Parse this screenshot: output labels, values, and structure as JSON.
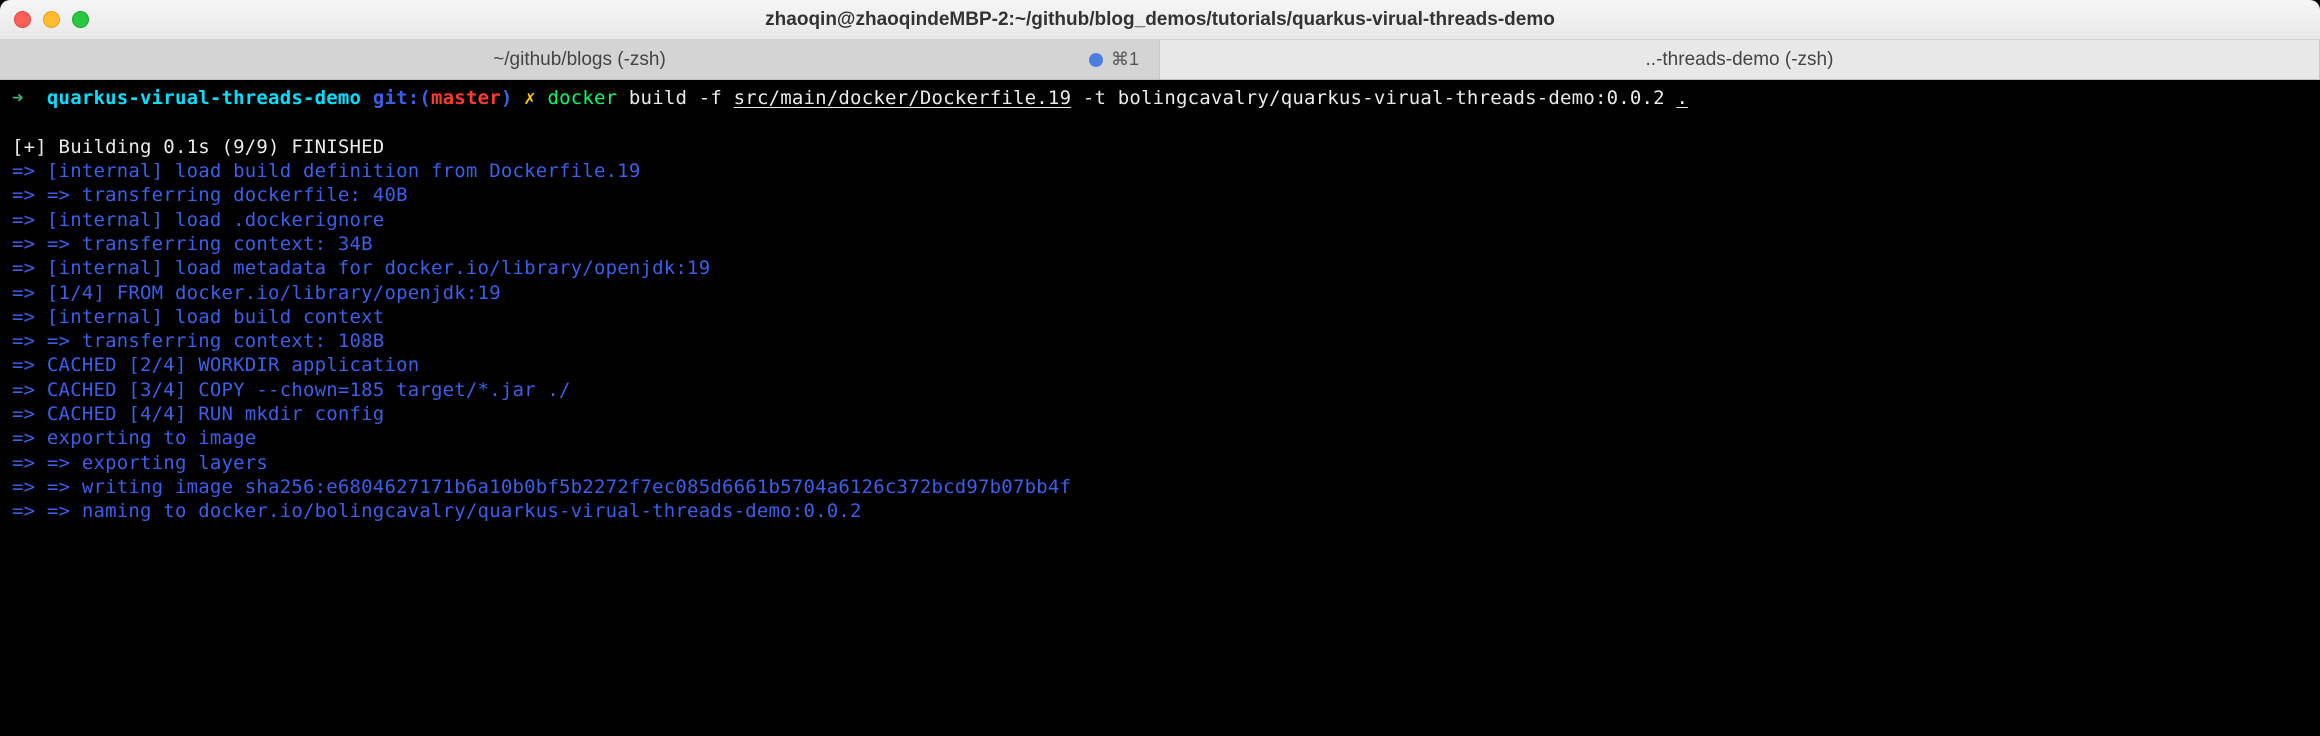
{
  "titlebar": {
    "title": "zhaoqin@zhaoqindeMBP-2:~/github/blog_demos/tutorials/quarkus-virual-threads-demo"
  },
  "tabs": [
    {
      "label": "~/github/blogs (-zsh)",
      "active": true,
      "shortcut": "⌘1"
    },
    {
      "label": "..-threads-demo (-zsh)",
      "active": false
    }
  ],
  "prompt": {
    "arrow": "➜",
    "dir": "quarkus-virual-threads-demo",
    "git_prefix": "git:(",
    "branch": "master",
    "git_suffix": ")",
    "dirty": "✗",
    "cmd_bin": "docker",
    "cmd_rest_before": " build -f ",
    "cmd_path": "src/main/docker/Dockerfile.19",
    "cmd_rest_after": " -t bolingcavalry/quarkus-virual-threads-demo:0.0.2 ",
    "cmd_dot": "."
  },
  "output": {
    "header": "[+] Building 0.1s (9/9) FINISHED",
    "lines": [
      "=> [internal] load build definition from Dockerfile.19",
      "=> => transferring dockerfile: 40B",
      "=> [internal] load .dockerignore",
      "=> => transferring context: 34B",
      "=> [internal] load metadata for docker.io/library/openjdk:19",
      "=> [1/4] FROM docker.io/library/openjdk:19",
      "=> [internal] load build context",
      "=> => transferring context: 108B",
      "=> CACHED [2/4] WORKDIR application",
      "=> CACHED [3/4] COPY --chown=185 target/*.jar ./",
      "=> CACHED [4/4] RUN mkdir config",
      "=> exporting to image",
      "=> => exporting layers",
      "=> => writing image sha256:e6804627171b6a10b0bf5b2272f7ec085d6661b5704a6126c372bcd97b07bb4f",
      "=> => naming to docker.io/bolingcavalry/quarkus-virual-threads-demo:0.0.2"
    ]
  }
}
